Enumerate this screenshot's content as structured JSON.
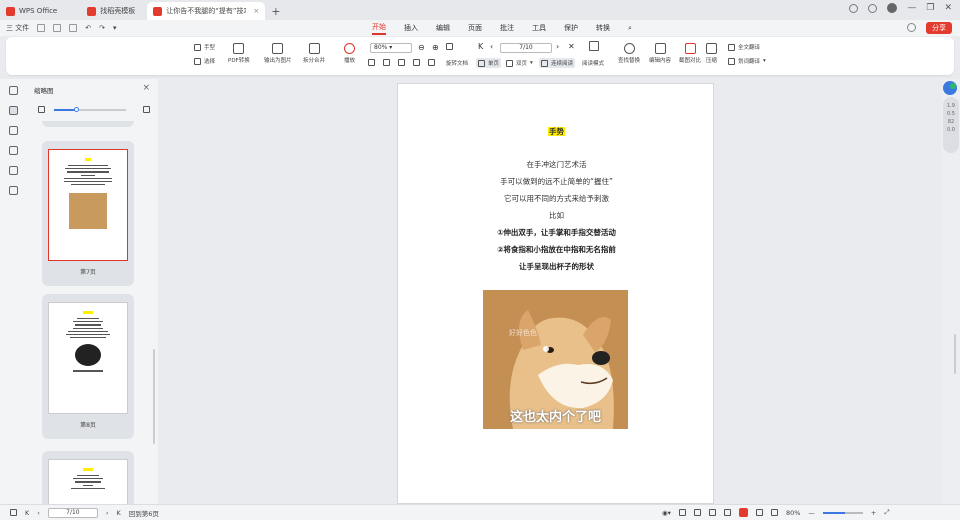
{
  "tabs": [
    {
      "label": "WPS Office",
      "color": "#e33b2e"
    },
    {
      "label": "找稻壳模板",
      "color": "#e33b2e"
    },
    {
      "label": "让你告不我腿的“提有”技巧",
      "color": "#e33b2e"
    }
  ],
  "menubar": {
    "file_label": "三 文件",
    "menus": [
      "开始",
      "插入",
      "编辑",
      "页面",
      "批注",
      "工具",
      "保护",
      "转换"
    ],
    "active_menu": "开始",
    "share_label": "分享"
  },
  "ribbon": {
    "hand": "手型",
    "select": "选择",
    "pdf_convert": "PDF转换",
    "to_image": "输出为图片",
    "split_merge": "拆分合并",
    "play": "播放",
    "zoom_value": "80%",
    "page_value": "7/10",
    "rotate": "旋转文档",
    "single_page": "单页",
    "double_page": "双页",
    "continuous": "连续阅读",
    "read_mode": "阅读模式",
    "find_replace": "查找替换",
    "edit_content": "编辑内容",
    "compare": "截图对比",
    "compress": "压缩",
    "full_translate": "全文翻译",
    "translate": "划词翻译"
  },
  "sidebar": {
    "title": "缩略图",
    "thumbnails": [
      {
        "label": "第7页",
        "selected": true
      },
      {
        "label": "第8页",
        "selected": false
      },
      {
        "label": "",
        "selected": false
      }
    ]
  },
  "document": {
    "title": "手势",
    "lines": [
      {
        "text": "在手冲这门艺术活",
        "bold": false
      },
      {
        "text": "手可以做到的远不止简单的“握住”",
        "bold": false
      },
      {
        "text": "它可以用不同的方式来给予刺激",
        "bold": false
      },
      {
        "text": "比如",
        "bold": false
      },
      {
        "text": "①伸出双手，让手掌和手指交替活动",
        "bold": true
      },
      {
        "text": "②将食指和小指放在中指和无名指前",
        "bold": true
      },
      {
        "text": "让手呈现出杯子的形状",
        "bold": true
      }
    ],
    "image_caption": "这也太内个了吧",
    "image_watermark": "好好色色"
  },
  "rightrail": {
    "values": [
      "1.9",
      "0.5",
      "82",
      "0.0"
    ]
  },
  "statusbar": {
    "page_value": "7/10",
    "back_label": "回到第6页",
    "zoom_value": "80%"
  }
}
